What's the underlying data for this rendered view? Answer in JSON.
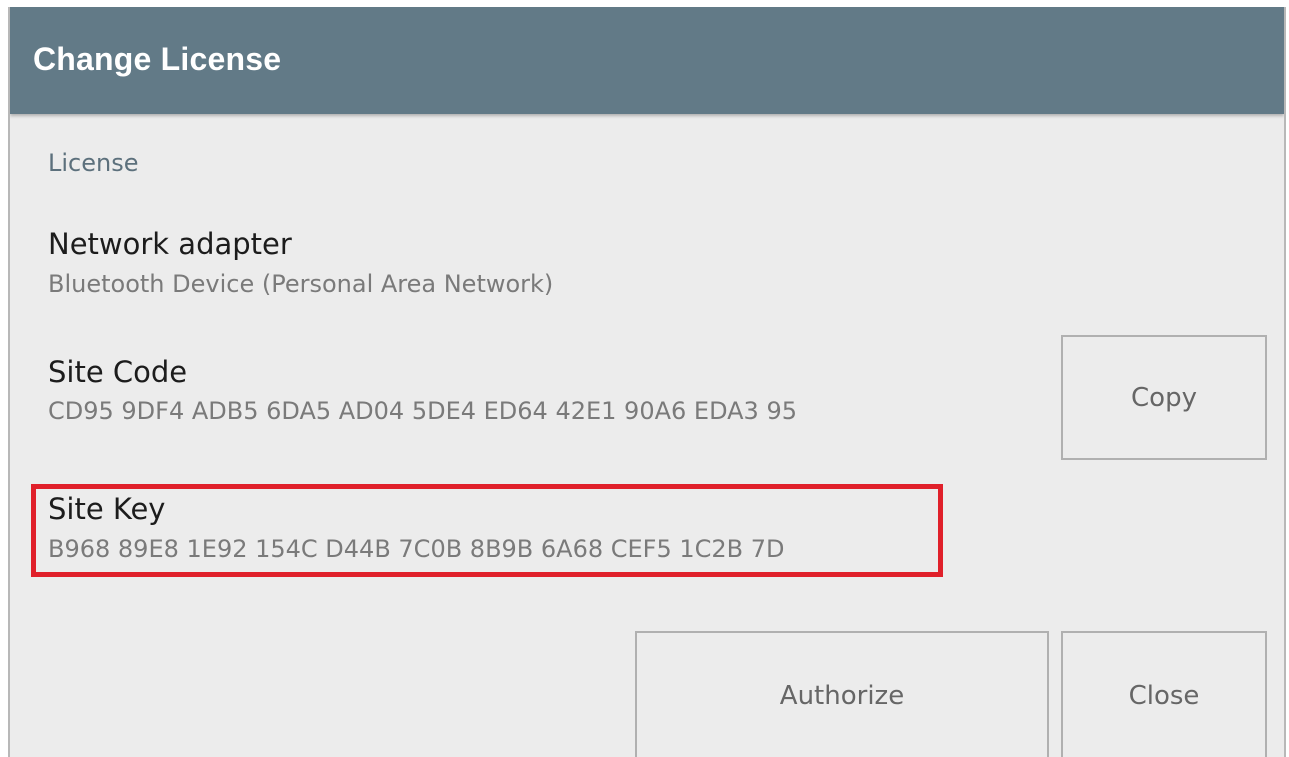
{
  "dialog": {
    "title": "Change License",
    "section_label": "License",
    "network_adapter": {
      "label": "Network adapter",
      "value": "Bluetooth Device (Personal Area Network)"
    },
    "site_code": {
      "label": "Site Code",
      "value": "CD95 9DF4 ADB5 6DA5 AD04 5DE4 ED64 42E1 90A6 EDA3 95"
    },
    "site_key": {
      "label": "Site Key",
      "value": "B968 89E8 1E92 154C D44B 7C0B 8B9B 6A68 CEF5 1C2B 7D"
    },
    "buttons": {
      "copy": "Copy",
      "authorize": "Authorize",
      "close": "Close"
    },
    "colors": {
      "titlebar": "#627a87",
      "background": "#ececec",
      "highlight": "#e0202a"
    }
  }
}
